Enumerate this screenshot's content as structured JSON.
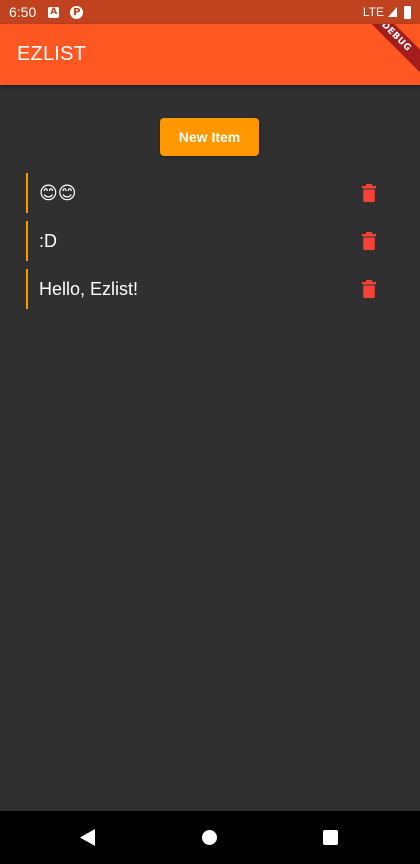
{
  "status_bar": {
    "time": "6:50",
    "notification_icons": [
      "A",
      "P"
    ],
    "network": "LTE",
    "icons": [
      "signal-icon",
      "battery-icon"
    ]
  },
  "app_bar": {
    "title": "EZLIST",
    "debug_banner": "DEBUG",
    "color": "#ff5722"
  },
  "main": {
    "new_item_button": "New Item",
    "button_color": "#ff9800",
    "items": [
      {
        "text": "😊😊"
      },
      {
        "text": ":D"
      },
      {
        "text": "Hello, Ezlist!"
      }
    ],
    "delete_icon": "trash-icon",
    "delete_color": "#f44336"
  },
  "nav_bar": {
    "icons": [
      "back-icon",
      "home-icon",
      "recents-icon"
    ]
  }
}
